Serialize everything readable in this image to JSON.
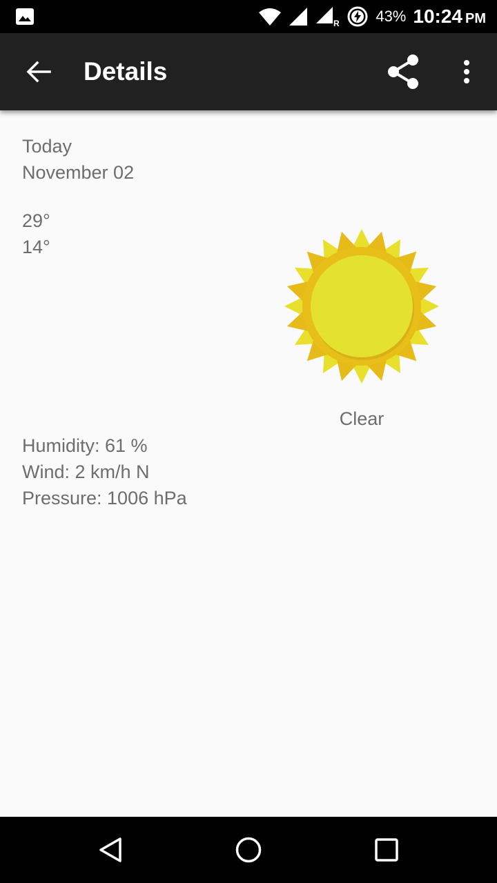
{
  "status_bar": {
    "battery_percent": "43%",
    "time": "10:24",
    "ampm": "PM",
    "icons": [
      "image-icon",
      "wifi-icon",
      "signal-icon",
      "signal-roaming-icon",
      "battery-charging-icon"
    ]
  },
  "app_bar": {
    "title": "Details",
    "icons": [
      "back-arrow-icon",
      "share-icon",
      "more-vert-icon"
    ],
    "background": "#212121"
  },
  "forecast": {
    "day": "Today",
    "date": "November 02",
    "high": "29°",
    "low": "14°",
    "condition": "Clear",
    "icon": "sun-icon",
    "humidity": "Humidity: 61 %",
    "wind": "Wind: 2 km/h N",
    "pressure": "Pressure: 1006 hPa"
  },
  "colors": {
    "text": "#6d6d6d",
    "sun_outer": "#e8bf18",
    "sun_inner": "#e4e22e",
    "background": "#fafafa"
  },
  "nav_bar": {
    "icons": [
      "back-triangle-icon",
      "home-circle-icon",
      "recents-square-icon"
    ]
  }
}
